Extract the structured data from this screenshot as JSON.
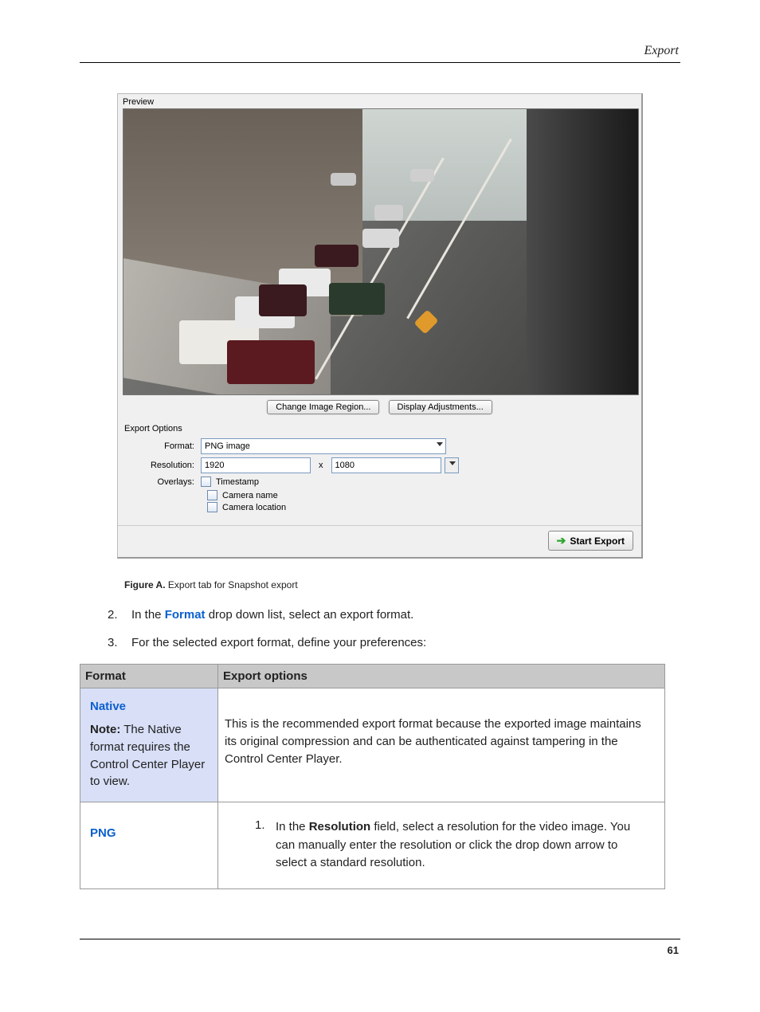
{
  "header": {
    "section": "Export"
  },
  "screenshot": {
    "preview_label": "Preview",
    "change_region_btn": "Change Image Region...",
    "display_adjustments_btn": "Display Adjustments...",
    "export_options_label": "Export Options",
    "format_label": "Format:",
    "format_value": "PNG image",
    "resolution_label": "Resolution:",
    "resolution_w": "1920",
    "resolution_sep": "x",
    "resolution_h": "1080",
    "overlays_label": "Overlays:",
    "overlay_timestamp": "Timestamp",
    "overlay_camera_name": "Camera name",
    "overlay_camera_location": "Camera location",
    "start_export_btn": "Start Export"
  },
  "caption": {
    "label": "Figure A.",
    "text": " Export tab for Snapshot export"
  },
  "steps": {
    "s2_num": "2.",
    "s2_a": "In the ",
    "s2_link": "Format",
    "s2_b": " drop down list, select an export format.",
    "s3_num": "3.",
    "s3_text": "For the selected export format, define your preferences:"
  },
  "table": {
    "head_format": "Format",
    "head_export_options": "Export options",
    "native": {
      "name": "Native",
      "note_label": "Note:",
      "note_text": "   The Native format requires the Control Center Player to view.",
      "desc": "This is the recommended export format because the exported image maintains its original compression and can be authenticated against tampering in the Control Center Player."
    },
    "png": {
      "name": "PNG",
      "item_num": "1.",
      "item_a": "In the ",
      "item_bold": "Resolution",
      "item_b": " field, select a resolution for the video image. You can manually enter the resolution or click the drop down arrow to select a standard resolution."
    }
  },
  "footer": {
    "page_number": "61"
  }
}
